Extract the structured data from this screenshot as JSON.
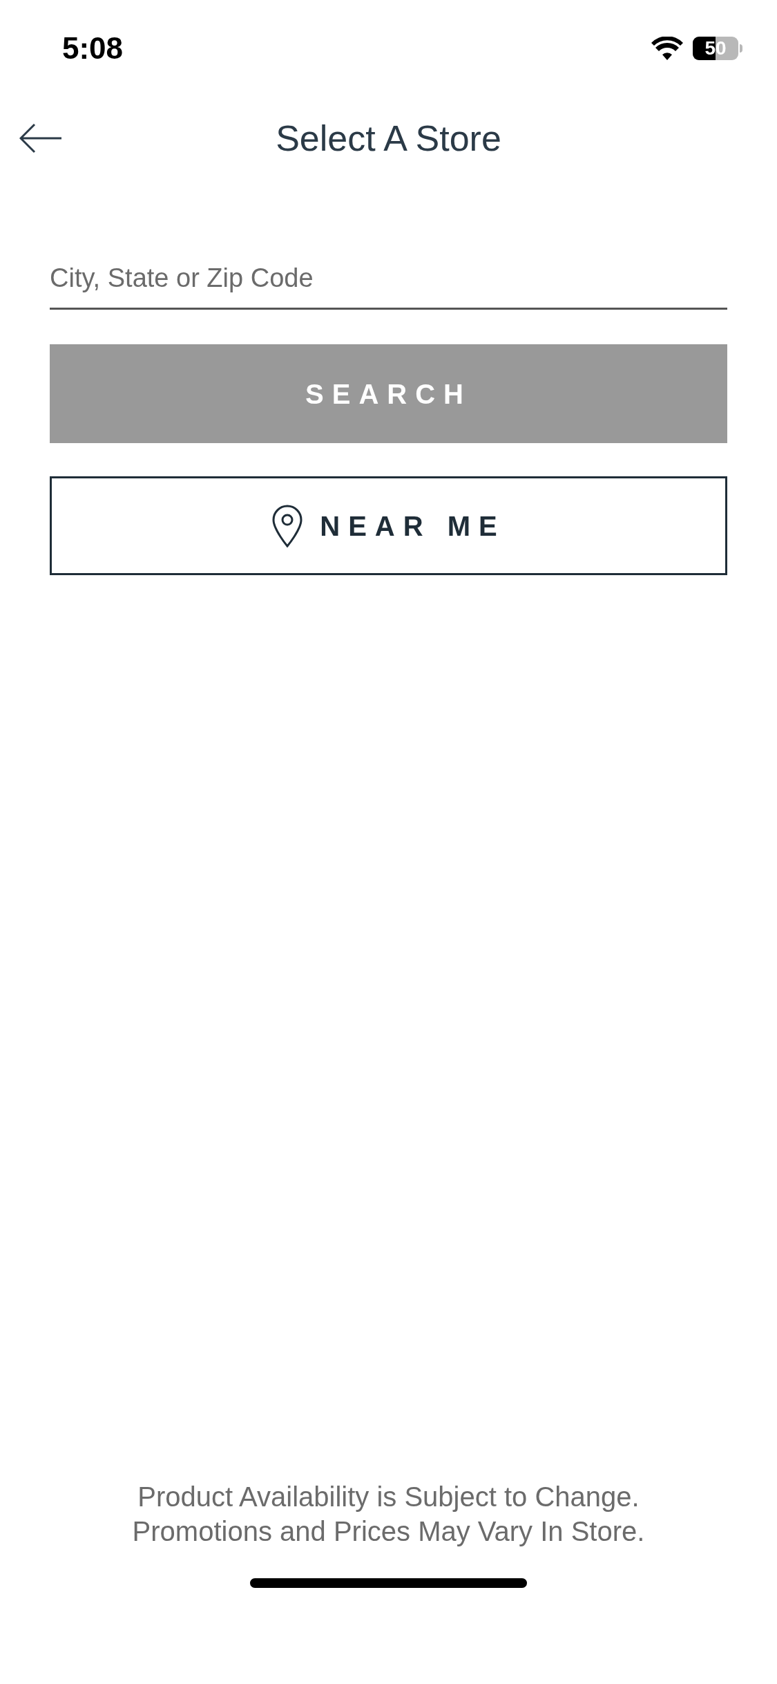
{
  "status_bar": {
    "time": "5:08",
    "battery": "50"
  },
  "header": {
    "title": "Select A Store"
  },
  "search": {
    "placeholder": "City, State or Zip Code",
    "button": "SEARCH",
    "disabled": true
  },
  "near_me": {
    "label": "NEAR ME"
  },
  "footer": [
    "Product Availability is Subject to Change.",
    "Promotions and Prices May Vary In Store."
  ]
}
